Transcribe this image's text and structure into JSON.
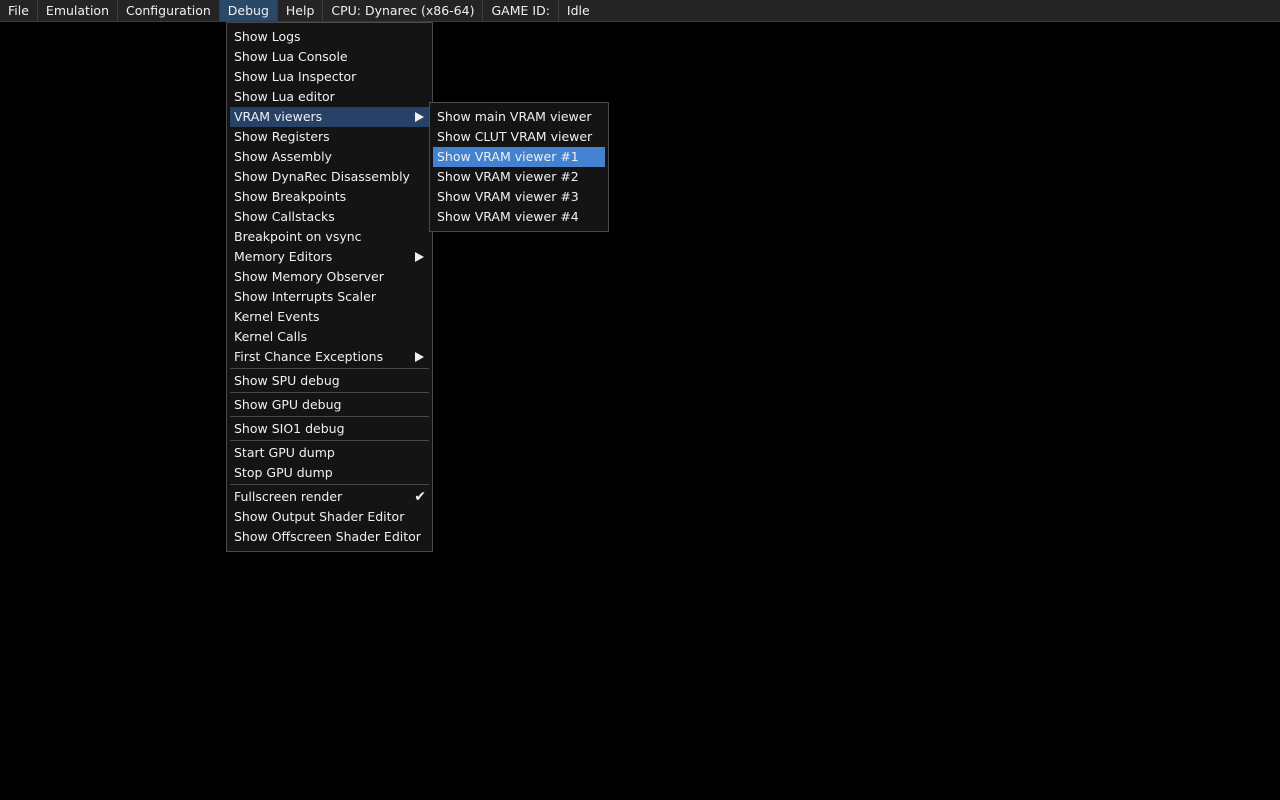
{
  "menubar": {
    "items": [
      "File",
      "Emulation",
      "Configuration",
      "Debug",
      "Help"
    ],
    "active": "Debug",
    "cpu": "CPU: Dynarec (x86-64)",
    "game_id": "GAME ID:",
    "status": "Idle"
  },
  "debug_menu": {
    "groups": [
      [
        "Show Logs",
        "Show Lua Console",
        "Show Lua Inspector",
        "Show Lua editor",
        "VRAM viewers",
        "Show Registers",
        "Show Assembly",
        "Show DynaRec Disassembly",
        "Show Breakpoints",
        "Show Callstacks",
        "Breakpoint on vsync",
        "Memory Editors",
        "Show Memory Observer",
        "Show Interrupts Scaler",
        "Kernel Events",
        "Kernel Calls",
        "First Chance Exceptions"
      ],
      [
        "Show SPU debug"
      ],
      [
        "Show GPU debug"
      ],
      [
        "Show SIO1 debug"
      ],
      [
        "Start GPU dump",
        "Stop GPU dump"
      ],
      [
        "Fullscreen render",
        "Show Output Shader Editor",
        "Show Offscreen Shader Editor"
      ]
    ],
    "submenus": [
      "VRAM viewers",
      "Memory Editors",
      "First Chance Exceptions"
    ],
    "checked": [
      "Fullscreen render"
    ],
    "hovered": "VRAM viewers"
  },
  "vram_menu": {
    "items": [
      "Show main VRAM viewer",
      "Show CLUT VRAM viewer",
      "Show VRAM viewer #1",
      "Show VRAM viewer #2",
      "Show VRAM viewer #3",
      "Show VRAM viewer #4"
    ],
    "selected": "Show VRAM viewer #1"
  },
  "colors": {
    "highlight": "#4282d0",
    "hover": "#274266",
    "menubar_active": "#2a4868"
  }
}
